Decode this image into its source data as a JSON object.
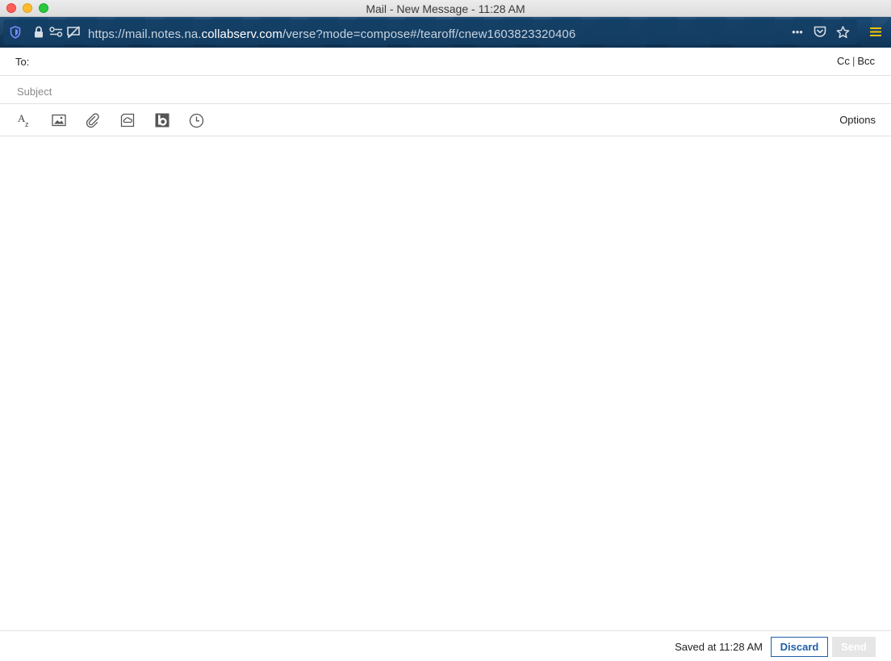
{
  "window": {
    "title": "Mail - New Message - 11:28 AM"
  },
  "browser": {
    "url_prefix": "https://mail.notes.na.",
    "url_domain": "collabserv.com",
    "url_suffix": "/verse?mode=compose#/tearoff/cnew1603823320406",
    "more_label": "•••",
    "icons": [
      "shield-icon",
      "lock-icon",
      "permissions-icon",
      "tracking-protection-icon",
      "more-icon",
      "pocket-icon",
      "star-icon",
      "menu-icon"
    ]
  },
  "compose": {
    "to_label": "To:",
    "to_value": "",
    "cc_label": "Cc",
    "separator": "|",
    "bcc_label": "Bcc",
    "subject_placeholder": "Subject",
    "subject_value": "",
    "body_value": ""
  },
  "toolbar": {
    "icons": [
      "text-format-icon",
      "image-icon",
      "attachment-icon",
      "cloud-file-icon",
      "box-icon",
      "clock-icon"
    ],
    "options_label": "Options"
  },
  "footer": {
    "saved_text": "Saved at 11:28 AM",
    "discard_label": "Discard",
    "send_label": "Send"
  },
  "colors": {
    "urlbar_bg": "#123d63",
    "accent_blue": "#1f5fa8",
    "menu_yellow": "#f2c000",
    "send_disabled": "#e6e6e6"
  }
}
